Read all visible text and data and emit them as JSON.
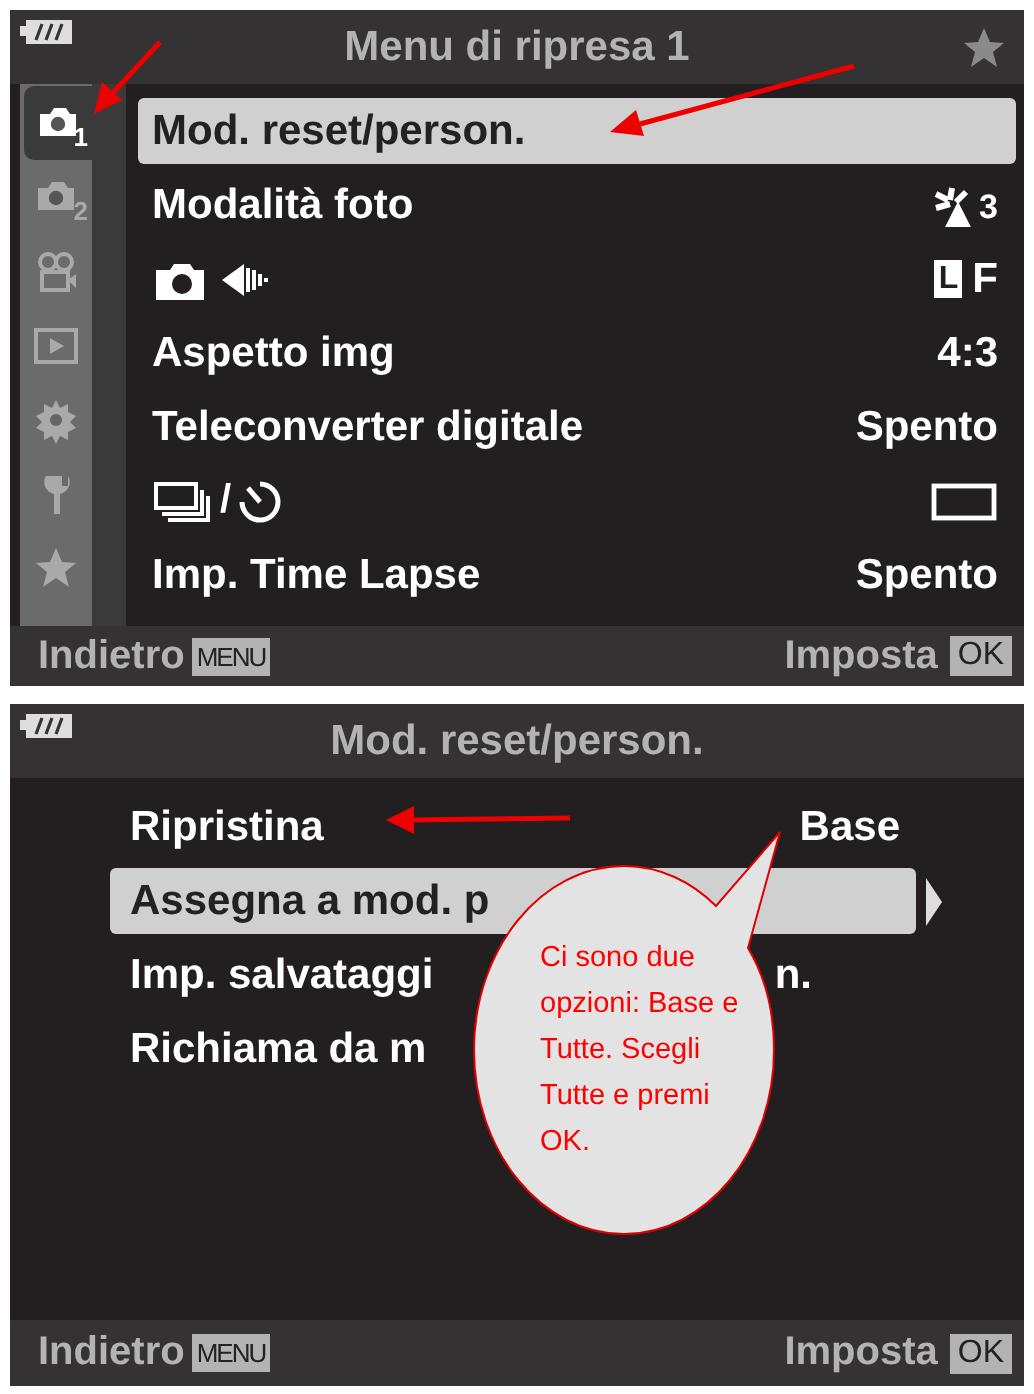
{
  "screens": [
    {
      "kind": "main",
      "title": "Menu di ripresa 1",
      "favorite_icon": true,
      "tabs": [
        {
          "kind": "camera",
          "sub": "1",
          "selected": true
        },
        {
          "kind": "camera",
          "sub": "2",
          "selected": false
        },
        {
          "kind": "movie",
          "selected": false
        },
        {
          "kind": "play",
          "selected": false
        },
        {
          "kind": "gear",
          "selected": false
        },
        {
          "kind": "wrench",
          "selected": false
        },
        {
          "kind": "star",
          "selected": false
        }
      ],
      "items": [
        {
          "kind": "text",
          "label": "Mod. reset/person.",
          "selected": true
        },
        {
          "kind": "photo-mode",
          "label": "Modalità foto",
          "value": "3",
          "selected": false
        },
        {
          "kind": "camera-quality",
          "value_mark": "L",
          "value": "F",
          "selected": false
        },
        {
          "kind": "text",
          "label": "Aspetto img",
          "value": "4:3",
          "selected": false
        },
        {
          "kind": "text",
          "label": "Teleconverter digitale",
          "value": "Spento",
          "selected": false
        },
        {
          "kind": "drive-timer",
          "label": "/",
          "selected": false
        },
        {
          "kind": "text",
          "label": "Imp. Time Lapse",
          "value": "Spento",
          "selected": false
        }
      ],
      "footer": {
        "back": "Indietro",
        "back_key": "MENU",
        "set": "Imposta",
        "set_key": "OK"
      }
    },
    {
      "kind": "sub",
      "title": "Mod. reset/person.",
      "favorite_icon": false,
      "items": [
        {
          "kind": "text",
          "label": "Ripristina",
          "value": "Base",
          "selected": false,
          "arrow": false
        },
        {
          "kind": "text",
          "label": "Assegna a mod. p",
          "selected": true,
          "arrow": true
        },
        {
          "kind": "tail",
          "label": "Imp. salvataggi",
          "value": "n.",
          "selected": false,
          "arrow": false
        },
        {
          "kind": "text",
          "label": "Richiama da m",
          "selected": false,
          "arrow": false
        }
      ],
      "callout": {
        "text": "Ci sono due opzioni: Base e Tutte. Scegli Tutte e premi OK."
      },
      "footer": {
        "back": "Indietro",
        "back_key": "MENU",
        "set": "Imposta",
        "set_key": "OK"
      }
    }
  ]
}
